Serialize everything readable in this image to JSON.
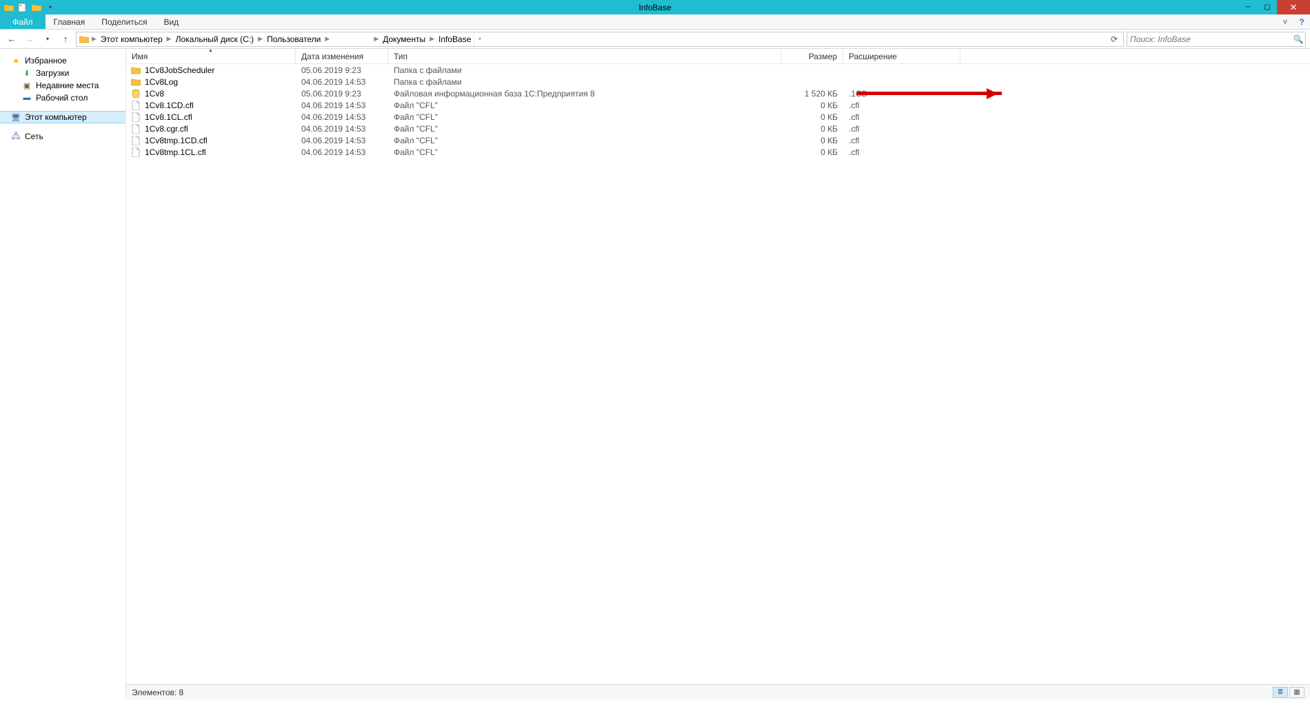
{
  "window": {
    "title": "InfoBase"
  },
  "ribbon": {
    "file": "Файл",
    "tabs": [
      "Главная",
      "Поделиться",
      "Вид"
    ]
  },
  "breadcrumbs": [
    "Этот компьютер",
    "Локальный диск (C:)",
    "Пользователи",
    "",
    "Документы",
    "InfoBase"
  ],
  "search": {
    "placeholder": "Поиск: InfoBase"
  },
  "navpane": {
    "fav_header": "Избранное",
    "favs": [
      {
        "label": "Загрузки",
        "icon": "downloads"
      },
      {
        "label": "Недавние места",
        "icon": "recent"
      },
      {
        "label": "Рабочий стол",
        "icon": "desktop"
      }
    ],
    "this_pc": "Этот компьютер",
    "network": "Сеть"
  },
  "columns": {
    "name": "Имя",
    "date": "Дата изменения",
    "type": "Тип",
    "size": "Размер",
    "ext": "Расширение"
  },
  "rows": [
    {
      "name": "1Cv8JobScheduler",
      "date": "05.06.2019 9:23",
      "type": "Папка с файлами",
      "size": "",
      "ext": "",
      "icon": "folder"
    },
    {
      "name": "1Cv8Log",
      "date": "04.06.2019 14:53",
      "type": "Папка с файлами",
      "size": "",
      "ext": "",
      "icon": "folder"
    },
    {
      "name": "1Cv8",
      "date": "05.06.2019 9:23",
      "type": "Файловая информационная база 1С:Предприятия 8",
      "size": "1 520 КБ",
      "ext": ".1CD",
      "icon": "db"
    },
    {
      "name": "1Cv8.1CD.cfl",
      "date": "04.06.2019 14:53",
      "type": "Файл \"CFL\"",
      "size": "0 КБ",
      "ext": ".cfl",
      "icon": "file"
    },
    {
      "name": "1Cv8.1CL.cfl",
      "date": "04.06.2019 14:53",
      "type": "Файл \"CFL\"",
      "size": "0 КБ",
      "ext": ".cfl",
      "icon": "file"
    },
    {
      "name": "1Cv8.cgr.cfl",
      "date": "04.06.2019 14:53",
      "type": "Файл \"CFL\"",
      "size": "0 КБ",
      "ext": ".cfl",
      "icon": "file"
    },
    {
      "name": "1Cv8tmp.1CD.cfl",
      "date": "04.06.2019 14:53",
      "type": "Файл \"CFL\"",
      "size": "0 КБ",
      "ext": ".cfl",
      "icon": "file"
    },
    {
      "name": "1Cv8tmp.1CL.cfl",
      "date": "04.06.2019 14:53",
      "type": "Файл \"CFL\"",
      "size": "0 КБ",
      "ext": ".cfl",
      "icon": "file"
    }
  ],
  "status": {
    "text": "Элементов: 8"
  }
}
